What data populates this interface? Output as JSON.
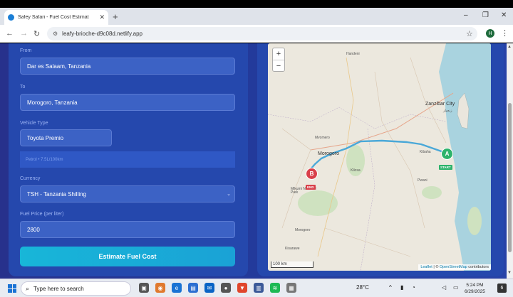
{
  "browser": {
    "tab_title": "Safey Safari - Fuel Cost Estimat",
    "tab_close": "✕",
    "new_tab": "+",
    "url": "leafy-brioche-d9c08d.netlify.app",
    "profile_initial": "H",
    "window_controls": [
      "–",
      "❐",
      "✕"
    ]
  },
  "form": {
    "from_label": "From",
    "from_value": "Dar es Salaam, Tanzania",
    "to_label": "To",
    "to_value": "Morogoro, Tanzania",
    "vehicle_label": "Vehicle Type",
    "vehicle_value": "Toyota Premio",
    "vehicle_info": "Petrol • 7.5L/100km",
    "currency_label": "Currency",
    "currency_value": "TSH - Tanzania Shilling",
    "fuel_price_label": "Fuel Price (per liter)",
    "fuel_price_value": "2800",
    "estimate_button": "Estimate Fuel Cost"
  },
  "map": {
    "zoom_in": "+",
    "zoom_out": "−",
    "scale": "100 km",
    "attribution_leaflet": "Leaflet",
    "attribution_sep": " | © ",
    "attribution_osm": "OpenStreetMap",
    "attribution_tail": " contributors",
    "marker_a": "A",
    "marker_a_tag": "START",
    "marker_b": "B",
    "marker_b_tag": "END",
    "labels": {
      "zanzibar": "Zanzibar City",
      "zanzibar_sw": "زنجبار",
      "morogoro": "Morogoro",
      "handeni": "Handeni",
      "kibaha": "Kibaha",
      "mvomero": "Mvomero",
      "kilosa": "Kilosa",
      "mikumi": "Mikumi National Park",
      "pwani": "Pwani",
      "morogoro_region": "Morogoro",
      "kisarawe": "Kisarawe"
    },
    "colors": {
      "route": "#4aa8d8",
      "sea": "#a9d3df",
      "marker_a": "#2db36b",
      "marker_b": "#d9404a"
    }
  },
  "taskbar": {
    "search_placeholder": "Type here to search",
    "weather": "28°C",
    "time": "5:24 PM",
    "date": "6/29/2025",
    "notifications": "6"
  }
}
